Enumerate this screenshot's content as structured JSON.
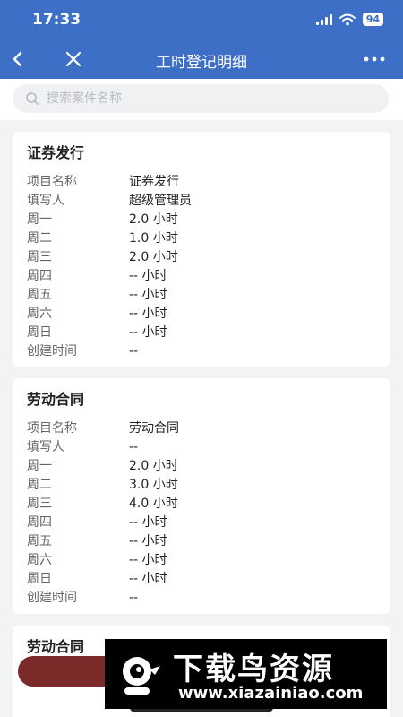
{
  "status": {
    "time": "17:33",
    "battery": "94"
  },
  "nav": {
    "title": "工时登记明细"
  },
  "search": {
    "placeholder": "搜索案件名称",
    "value": ""
  },
  "cards": [
    {
      "title": "证券发行",
      "rows": [
        {
          "label": "项目名称",
          "value": "证券发行"
        },
        {
          "label": "填写人",
          "value": "超级管理员"
        },
        {
          "label": "周一",
          "value": "2.0 小时"
        },
        {
          "label": "周二",
          "value": "1.0 小时"
        },
        {
          "label": "周三",
          "value": "2.0 小时"
        },
        {
          "label": "周四",
          "value": "-- 小时"
        },
        {
          "label": "周五",
          "value": "-- 小时"
        },
        {
          "label": "周六",
          "value": "-- 小时"
        },
        {
          "label": "周日",
          "value": "-- 小时"
        },
        {
          "label": "创建时间",
          "value": "--"
        }
      ]
    },
    {
      "title": "劳动合同",
      "rows": [
        {
          "label": "项目名称",
          "value": "劳动合同"
        },
        {
          "label": "填写人",
          "value": "--"
        },
        {
          "label": "周一",
          "value": "2.0 小时"
        },
        {
          "label": "周二",
          "value": "3.0 小时"
        },
        {
          "label": "周三",
          "value": "4.0 小时"
        },
        {
          "label": "周四",
          "value": "-- 小时"
        },
        {
          "label": "周五",
          "value": "-- 小时"
        },
        {
          "label": "周六",
          "value": "-- 小时"
        },
        {
          "label": "周日",
          "value": "-- 小时"
        },
        {
          "label": "创建时间",
          "value": "--"
        }
      ]
    },
    {
      "title": "劳动合同",
      "rows": []
    }
  ],
  "watermark": {
    "title": "下载鸟资源",
    "url": "www.xiazainiao.com"
  }
}
